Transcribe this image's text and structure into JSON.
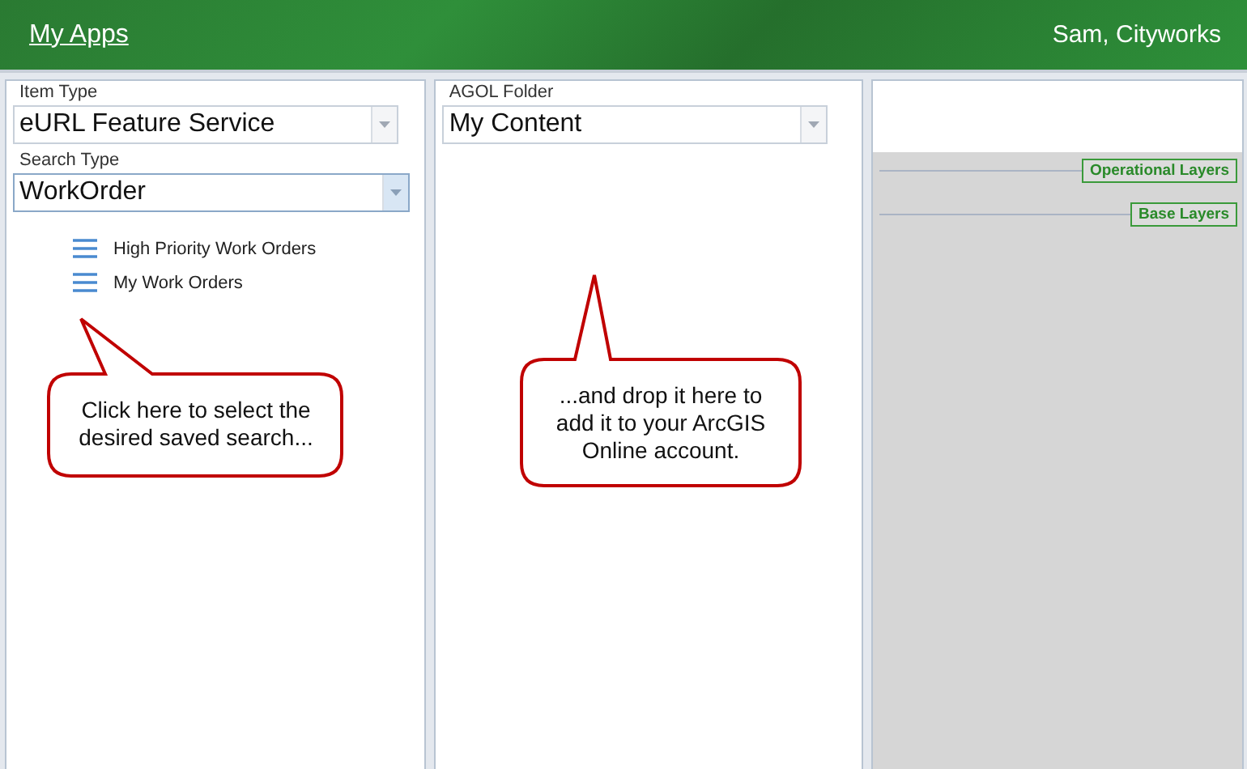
{
  "header": {
    "title": "My Apps",
    "user": "Sam, Cityworks"
  },
  "left_panel": {
    "item_type": {
      "label": "Item Type",
      "value": "eURL Feature Service"
    },
    "search_type": {
      "label": "Search Type",
      "value": "WorkOrder"
    },
    "saved_searches": [
      "High Priority Work Orders",
      "My Work Orders"
    ]
  },
  "middle_panel": {
    "agol_folder": {
      "label": "AGOL Folder",
      "value": "My Content"
    }
  },
  "right_panel": {
    "layer_groups": [
      "Operational Layers",
      "Base Layers"
    ]
  },
  "callouts": [
    {
      "text": "Click here to select the desired saved search..."
    },
    {
      "text": "...and drop it here to add it to your ArcGIS Online account."
    }
  ]
}
